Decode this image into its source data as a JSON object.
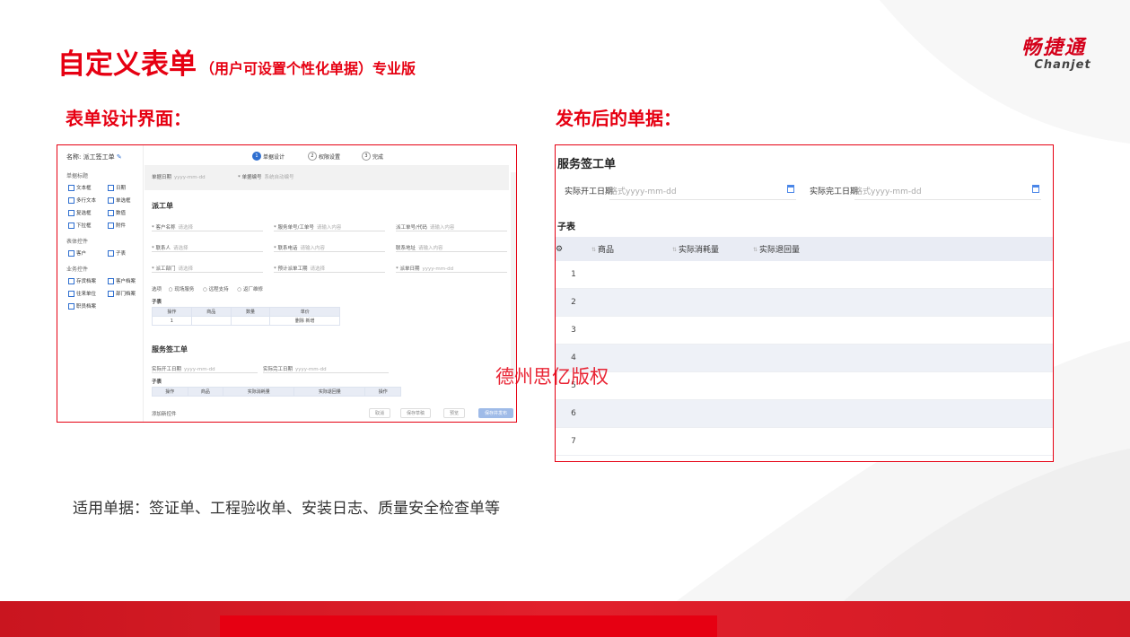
{
  "header": {
    "title": "自定义表单",
    "subtitle": "（用户可设置个性化单据）专业版",
    "logo_cn": "畅捷通",
    "logo_en": "Chanjet"
  },
  "sections": {
    "left_title": "表单设计界面：",
    "right_title": "发布后的单据："
  },
  "designer": {
    "name_label": "名称: 派工签工单",
    "edit_icon": "pencil-icon",
    "steps": [
      {
        "num": "1",
        "label": "单据设计"
      },
      {
        "num": "2",
        "label": "权限设置"
      },
      {
        "num": "3",
        "label": "完成"
      }
    ],
    "sidebar": {
      "group1": "单据标题",
      "group1_items": [
        "文本框",
        "日期",
        "多行文本",
        "单选框",
        "复选框",
        "数值",
        "下拉框",
        "附件"
      ],
      "group2": "表体控件",
      "group2_items": [
        "客户",
        "子表"
      ],
      "group3": "业务控件",
      "group3_items": [
        "存货档案",
        "客户档案",
        "往来单位",
        "部门档案",
        "职员档案"
      ]
    },
    "top_fields": {
      "date_label": "单据日期",
      "date_ph": "yyyy-mm-dd",
      "code_label": "* 单据编号",
      "code_ph": "系统自动编号"
    },
    "form_title": "派工单",
    "fields": [
      {
        "label": "* 客户名称",
        "ph": "请选择"
      },
      {
        "label": "* 服务单号/工单号",
        "ph": "请输入内容"
      },
      {
        "label": "派工单号/代码",
        "ph": "请输入内容"
      },
      {
        "label": "* 联系人",
        "ph": "请选择"
      },
      {
        "label": "* 联系电话",
        "ph": "请输入内容"
      },
      {
        "label": "联系地址",
        "ph": "请输入内容"
      },
      {
        "label": "* 派工部门",
        "ph": "请选择"
      },
      {
        "label": "* 预计派单工期",
        "ph": "请选择"
      },
      {
        "label": "* 派单日期",
        "ph": "yyyy-mm-dd"
      }
    ],
    "radio_label": "选项",
    "radios": [
      "现场服务",
      "远程支持",
      "返厂维修"
    ],
    "subtable_label": "子表",
    "mini_table": {
      "headers": [
        "操作",
        "商品",
        "数量",
        "单价"
      ],
      "row": [
        "1",
        "",
        "",
        "删除 新增"
      ]
    },
    "form2_title": "服务签工单",
    "form2_fields": [
      {
        "label": "实际开工日期",
        "ph": "yyyy-mm-dd"
      },
      {
        "label": "实际完工日期",
        "ph": "yyyy-mm-dd"
      }
    ],
    "subtable2_label": "子表",
    "mini_table2": {
      "headers": [
        "操作",
        "商品",
        "实际消耗量",
        "实际退回量",
        "操作"
      ]
    },
    "footer_note": "添加新控件",
    "buttons": [
      "取消",
      "保存草稿",
      "预览",
      "保存并发布"
    ]
  },
  "published": {
    "title": "服务签工单",
    "start_label": "实际开工日期",
    "start_ph": "格式yyyy-mm-dd",
    "end_label": "实际完工日期",
    "end_ph": "格式yyyy-mm-dd",
    "subtable_label": "子表",
    "columns": [
      "商品",
      "实际消耗量",
      "实际退回量"
    ],
    "rows": [
      "1",
      "2",
      "3",
      "4",
      "5",
      "6",
      "7"
    ]
  },
  "watermark": "德州思亿版权",
  "bottom_text": "适用单据：签证单、工程验收单、安装日志、质量安全检查单等",
  "colors": {
    "brand": "#e60012",
    "accent": "#2f6fd0"
  }
}
